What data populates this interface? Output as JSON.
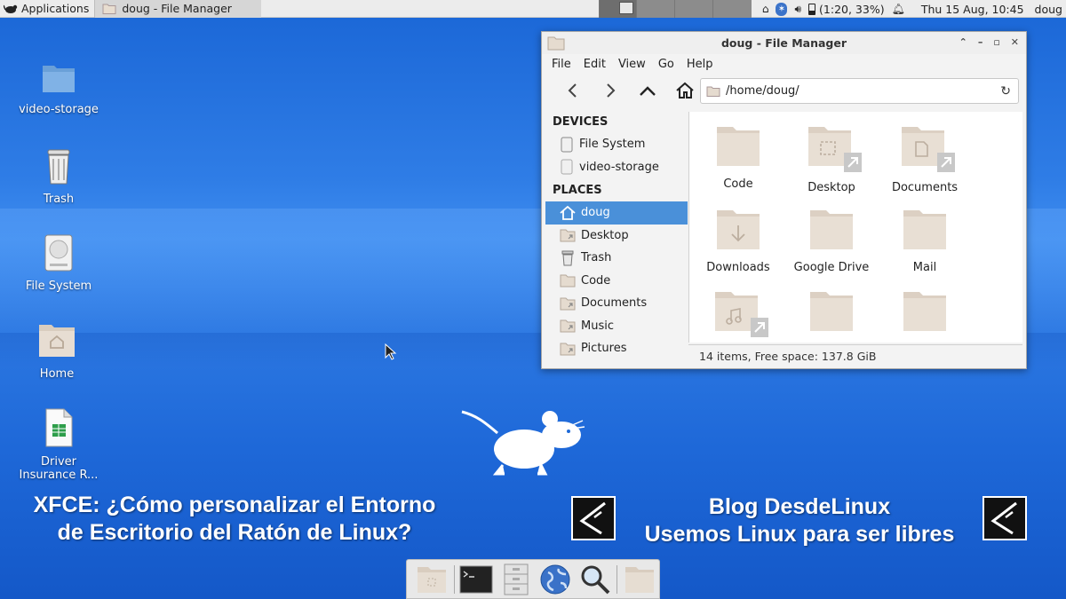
{
  "topbar": {
    "applications_label": "Applications",
    "task_label": "doug - File Manager",
    "battery_text": "(1:20, 33%)",
    "clock": "Thu 15 Aug, 10:45",
    "user": "doug"
  },
  "desktop_icons": [
    {
      "label": "video-storage",
      "icon": "folder-icon"
    },
    {
      "label": "Trash",
      "icon": "trash-icon"
    },
    {
      "label": "File System",
      "icon": "drive-icon"
    },
    {
      "label": "Home",
      "icon": "home-folder-icon"
    },
    {
      "label": "Driver Insurance R...",
      "icon": "spreadsheet-icon"
    }
  ],
  "window": {
    "title": "doug - File Manager",
    "menu": [
      "File",
      "Edit",
      "View",
      "Go",
      "Help"
    ],
    "path": "/home/doug/",
    "sidebar": {
      "devices_heading": "DEVICES",
      "devices": [
        "File System",
        "video-storage"
      ],
      "places_heading": "PLACES",
      "places": [
        "doug",
        "Desktop",
        "Trash",
        "Code",
        "Documents",
        "Music",
        "Pictures"
      ],
      "selected": "doug"
    },
    "items": [
      {
        "name": "Code",
        "icon": "folder-icon"
      },
      {
        "name": "Desktop",
        "icon": "desktop-folder-link-icon"
      },
      {
        "name": "Documents",
        "icon": "documents-folder-link-icon"
      },
      {
        "name": "Downloads",
        "icon": "downloads-folder-icon"
      },
      {
        "name": "Google Drive",
        "icon": "folder-icon"
      },
      {
        "name": "Mail",
        "icon": "folder-icon"
      },
      {
        "name": "",
        "icon": "music-folder-link-icon"
      },
      {
        "name": "",
        "icon": "folder-icon"
      },
      {
        "name": "",
        "icon": "folder-icon"
      }
    ],
    "status": "14 items, Free space: 137.8 GiB"
  },
  "overlay": {
    "left_line1": "XFCE: ¿Cómo personalizar el Entorno",
    "left_line2": "de Escritorio del Ratón de Linux?",
    "right_line1": "Blog DesdeLinux",
    "right_line2": "Usemos Linux para ser libres"
  },
  "dock": [
    "home-folder-icon",
    "terminal-icon",
    "file-cabinet-icon",
    "web-browser-icon",
    "search-icon",
    "folder-icon"
  ],
  "colors": {
    "desktop": "#2a76e0",
    "selection": "#4a90d9",
    "folder": "#e6ddd2"
  }
}
